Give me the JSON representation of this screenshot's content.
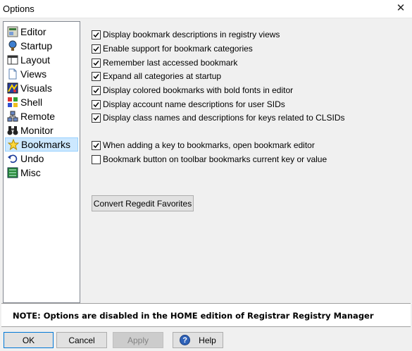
{
  "window": {
    "title": "Options",
    "close_glyph": "✕"
  },
  "nav": {
    "items": [
      {
        "label": "Editor",
        "icon": "editor-icon"
      },
      {
        "label": "Startup",
        "icon": "startup-icon"
      },
      {
        "label": "Layout",
        "icon": "layout-icon"
      },
      {
        "label": "Views",
        "icon": "views-icon"
      },
      {
        "label": "Visuals",
        "icon": "visuals-icon"
      },
      {
        "label": "Shell",
        "icon": "shell-icon"
      },
      {
        "label": "Remote",
        "icon": "remote-icon"
      },
      {
        "label": "Monitor",
        "icon": "monitor-icon"
      },
      {
        "label": "Bookmarks",
        "icon": "bookmarks-star-icon",
        "selected": true
      },
      {
        "label": "Undo",
        "icon": "undo-icon"
      },
      {
        "label": "Misc",
        "icon": "misc-icon"
      }
    ]
  },
  "options": [
    {
      "label": "Display bookmark descriptions in registry views",
      "checked": true
    },
    {
      "label": "Enable support for bookmark categories",
      "checked": true
    },
    {
      "label": "Remember last accessed bookmark",
      "checked": true
    },
    {
      "label": "Expand all categories at startup",
      "checked": true
    },
    {
      "label": "Display colored bookmarks with bold fonts in editor",
      "checked": true
    },
    {
      "label": "Display account name descriptions for user SIDs",
      "checked": true
    },
    {
      "label": "Display class names and descriptions for keys related to CLSIDs",
      "checked": true
    },
    {
      "label": "When adding a key to bookmarks, open bookmark editor",
      "checked": true
    },
    {
      "label": "Bookmark button on toolbar bookmarks current key or value",
      "checked": false
    }
  ],
  "convert_button": {
    "label": "Convert Regedit Favorites"
  },
  "note": {
    "text": "NOTE: Options are disabled in the HOME edition of Registrar Registry Manager"
  },
  "buttons": {
    "ok": "OK",
    "cancel": "Cancel",
    "apply": "Apply",
    "help": "Help",
    "help_glyph": "?"
  },
  "colors": {
    "selection_bg": "#cce8ff",
    "help_icon": "#2f62b8"
  }
}
